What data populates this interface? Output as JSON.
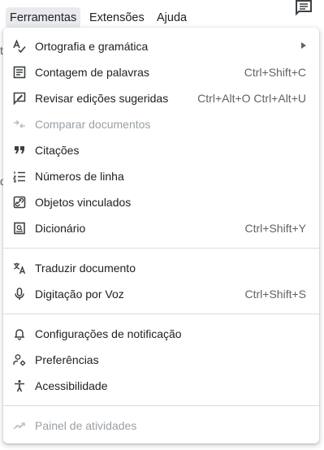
{
  "menubar": {
    "items": [
      "Ferramentas",
      "Extensões",
      "Ajuda"
    ]
  },
  "icons": {
    "comment": "comment-icon"
  },
  "background": {
    "left_char_1": "t",
    "left_char_2": "d"
  },
  "menu": {
    "groups": [
      [
        {
          "label": "Ortografia e gramática",
          "shortcut": "",
          "icon": "spellcheck-icon",
          "submenu": true
        },
        {
          "label": "Contagem de palavras",
          "shortcut": "Ctrl+Shift+C",
          "icon": "word-count-icon"
        },
        {
          "label": "Revisar edições sugeridas",
          "shortcut": "Ctrl+Alt+O Ctrl+Alt+U",
          "icon": "review-suggestions-icon"
        },
        {
          "label": "Comparar documentos",
          "shortcut": "",
          "icon": "compare-icon",
          "disabled": true
        },
        {
          "label": "Citações",
          "shortcut": "",
          "icon": "quote-icon"
        },
        {
          "label": "Números de linha",
          "shortcut": "",
          "icon": "line-numbers-icon"
        },
        {
          "label": "Objetos vinculados",
          "shortcut": "",
          "icon": "linked-objects-icon"
        },
        {
          "label": "Dicionário",
          "shortcut": "Ctrl+Shift+Y",
          "icon": "dictionary-icon"
        }
      ],
      [
        {
          "label": "Traduzir documento",
          "shortcut": "",
          "icon": "translate-icon"
        },
        {
          "label": "Digitação por Voz",
          "shortcut": "Ctrl+Shift+S",
          "icon": "microphone-icon"
        }
      ],
      [
        {
          "label": "Configurações de notificação",
          "shortcut": "",
          "icon": "bell-icon"
        },
        {
          "label": "Preferências",
          "shortcut": "",
          "icon": "preferences-icon"
        },
        {
          "label": "Acessibilidade",
          "shortcut": "",
          "icon": "accessibility-icon"
        }
      ],
      [
        {
          "label": "Painel de atividades",
          "shortcut": "",
          "icon": "activity-dashboard-icon",
          "disabled": true
        }
      ]
    ]
  }
}
